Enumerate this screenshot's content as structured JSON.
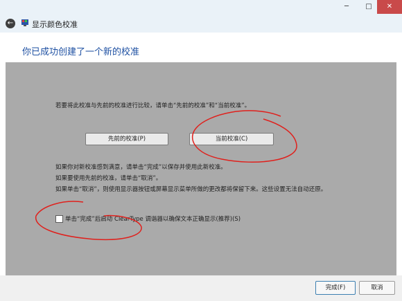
{
  "window": {
    "title": "显示颜色校准",
    "back_glyph": "←",
    "minimize_glyph": "─",
    "maximize_glyph": "□",
    "close_glyph": "✕"
  },
  "heading": "你已成功创建了一个新的校准",
  "instruction": "若要将此校准与先前的校准进行比较，请单击“先前的校准”和“当前校准”。",
  "buttons": {
    "previous": "先前的校准(P)",
    "current": "当前校准(C)",
    "finish": "完成(F)",
    "cancel": "取消"
  },
  "info_lines": [
    "如果你对新校准感到满意，请单击“完成”以保存并使用此新校准。",
    "如果要使用先前的校准，请单击“取消”。",
    "如果单击“取消”，则使用显示器按钮或屏幕显示菜单所做的更改都将保留下来。这些设置无法自动还原。"
  ],
  "checkbox_label": "单击“完成”后启动 ClearType 调谐器以确保文本正确显示(推荐)(S)",
  "checkbox_checked": false,
  "colors": {
    "content_bg": "#aaaaaa",
    "heading": "#1e50a2",
    "annotation": "#e0201c"
  }
}
